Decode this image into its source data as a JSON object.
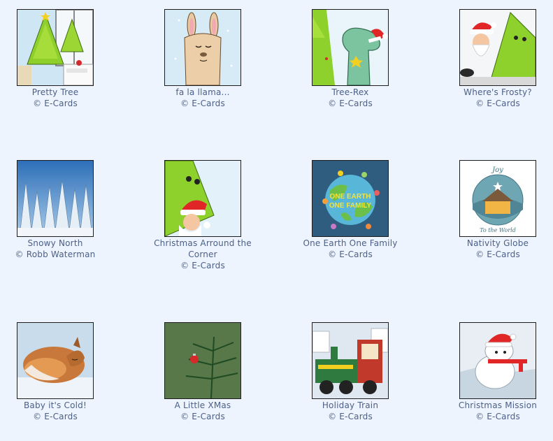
{
  "cards": [
    {
      "title": "Pretty Tree",
      "credit": "© E-Cards",
      "icon": "christmas-tree-window-icon"
    },
    {
      "title": "fa la llama...",
      "credit": "© E-Cards",
      "icon": "llama-icon"
    },
    {
      "title": "Tree-Rex",
      "credit": "© E-Cards",
      "icon": "dinosaur-santa-hat-icon"
    },
    {
      "title": "Where's Frosty?",
      "credit": "© E-Cards",
      "icon": "santa-and-tree-icon"
    },
    {
      "title": "Snowy North",
      "credit": "© Robb Waterman",
      "icon": "snowy-forest-icon"
    },
    {
      "title": "Christmas Arround the Corner",
      "credit": "© E-Cards",
      "icon": "tree-and-santa-peeking-icon"
    },
    {
      "title": "One Earth One Family",
      "credit": "© E-Cards",
      "icon": "earth-globe-icon"
    },
    {
      "title": "Nativity Globe",
      "credit": "© E-Cards",
      "icon": "nativity-snowglobe-icon"
    },
    {
      "title": "Baby it's Cold!",
      "credit": "© E-Cards",
      "icon": "sleeping-fox-icon"
    },
    {
      "title": "A Little XMas",
      "credit": "© E-Cards",
      "icon": "pine-branch-ornament-icon"
    },
    {
      "title": "Holiday Train",
      "credit": "© E-Cards",
      "icon": "holiday-train-icon"
    },
    {
      "title": "Christmas Mission",
      "credit": "© E-Cards",
      "icon": "polar-bear-santa-hat-icon"
    }
  ],
  "thumbnail_text": {
    "earth_line1": "ONE EARTH",
    "earth_line2": "ONE FAMILY",
    "globe_top": "Joy",
    "globe_bottom": "To the World"
  }
}
